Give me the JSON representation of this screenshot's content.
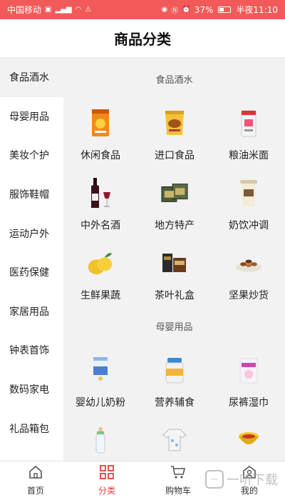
{
  "status_bar": {
    "carrier": "中国移动",
    "battery": "37%",
    "time": "半夜11:10"
  },
  "header": {
    "title": "商品分类"
  },
  "sidebar": {
    "items": [
      {
        "label": "食品酒水"
      },
      {
        "label": "母婴用品"
      },
      {
        "label": "美妆个护"
      },
      {
        "label": "服饰鞋帽"
      },
      {
        "label": "运动户外"
      },
      {
        "label": "医药保健"
      },
      {
        "label": "家居用品"
      },
      {
        "label": "钟表首饰"
      },
      {
        "label": "数码家电"
      },
      {
        "label": "礼品箱包"
      }
    ]
  },
  "content": {
    "sections": [
      {
        "title": "食品酒水",
        "items": [
          {
            "label": "休闲食品",
            "icon": "snack-bag-icon"
          },
          {
            "label": "进口食品",
            "icon": "imported-snack-icon"
          },
          {
            "label": "粮油米面",
            "icon": "flour-bag-icon"
          },
          {
            "label": "中外名酒",
            "icon": "wine-bottle-icon"
          },
          {
            "label": "地方特产",
            "icon": "gift-box-icon"
          },
          {
            "label": "奶饮冲调",
            "icon": "milk-tea-cup-icon"
          },
          {
            "label": "生鲜果蔬",
            "icon": "fruit-icon"
          },
          {
            "label": "茶叶礼盒",
            "icon": "tea-box-icon"
          },
          {
            "label": "坚果炒货",
            "icon": "nuts-plate-icon"
          }
        ]
      },
      {
        "title": "母婴用品",
        "items": [
          {
            "label": "婴幼儿奶粉",
            "icon": "formula-can-icon"
          },
          {
            "label": "营养辅食",
            "icon": "baby-food-jar-icon"
          },
          {
            "label": "尿裤湿巾",
            "icon": "diaper-pack-icon"
          },
          {
            "label": "",
            "icon": "baby-bottle-icon"
          },
          {
            "label": "",
            "icon": "baby-romper-icon"
          },
          {
            "label": "",
            "icon": "baby-bowl-icon"
          }
        ]
      }
    ]
  },
  "bottom_nav": {
    "items": [
      {
        "label": "首页",
        "icon": "home-icon"
      },
      {
        "label": "分类",
        "icon": "category-grid-icon"
      },
      {
        "label": "购物车",
        "icon": "cart-icon"
      },
      {
        "label": "我的",
        "icon": "profile-icon"
      }
    ]
  },
  "watermark": {
    "badge": "一",
    "text": "一听下载"
  },
  "colors": {
    "status_bar": "#f25a5a",
    "accent": "#e23c3c",
    "background": "#f2f2f2"
  }
}
